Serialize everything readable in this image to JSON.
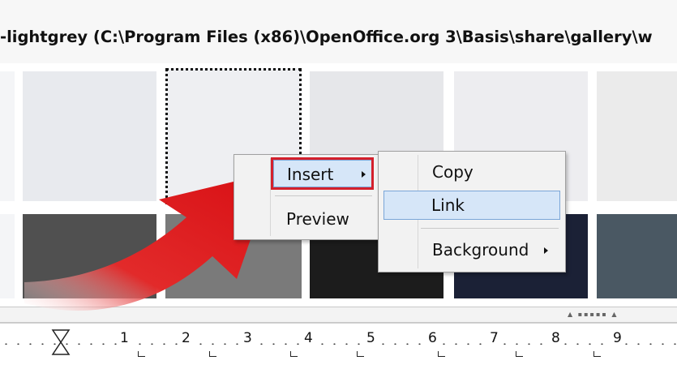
{
  "window": {
    "title": "-lightgrey (C:\\Program Files (x86)\\OpenOffice.org 3\\Basis\\share\\gallery\\w"
  },
  "context_menu": {
    "items": [
      {
        "label": "Insert",
        "accel": "I",
        "has_submenu": true,
        "highlighted": true
      },
      {
        "label": "Preview",
        "accel": "P",
        "has_submenu": false
      }
    ]
  },
  "submenu": {
    "items": [
      {
        "label": "Copy",
        "accel": "C"
      },
      {
        "label": "Link",
        "accel": "L",
        "highlighted": true
      },
      {
        "label": "Background",
        "accel": "k",
        "has_submenu": true
      }
    ]
  },
  "ruler": {
    "numbers": [
      "1",
      "2",
      "3",
      "4",
      "5",
      "6",
      "7",
      "8",
      "9"
    ]
  },
  "colors": {
    "highlight_fill": "#d6e6f8",
    "highlight_border": "#7aa6d8",
    "annotation_red": "#d4202c"
  },
  "icons": {
    "submenu_arrow": "triangle-right",
    "ruler_indent": "hourglass"
  }
}
